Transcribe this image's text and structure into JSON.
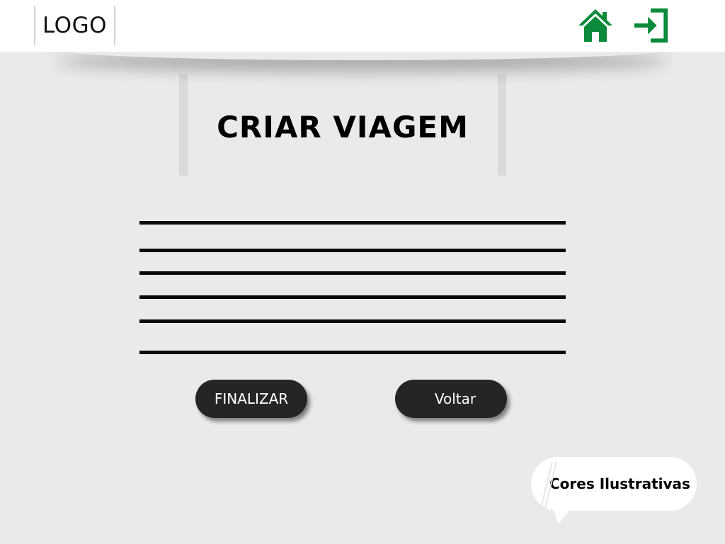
{
  "header": {
    "logo_text": "LOGO",
    "home_icon": "home-icon",
    "logout_icon": "sign-in-icon",
    "icon_color": "#0a8a3a"
  },
  "main": {
    "title": "CRIAR VIAGEM",
    "form_line_count": 6
  },
  "actions": {
    "finalizar_label": "FINALIZAR",
    "voltar_label": "Voltar"
  },
  "note": {
    "text": "Cores Ilustrativas"
  },
  "colors": {
    "background": "#e9eaec",
    "header": "#ffffff",
    "button": "#252527",
    "accent": "#0a8a3a"
  }
}
